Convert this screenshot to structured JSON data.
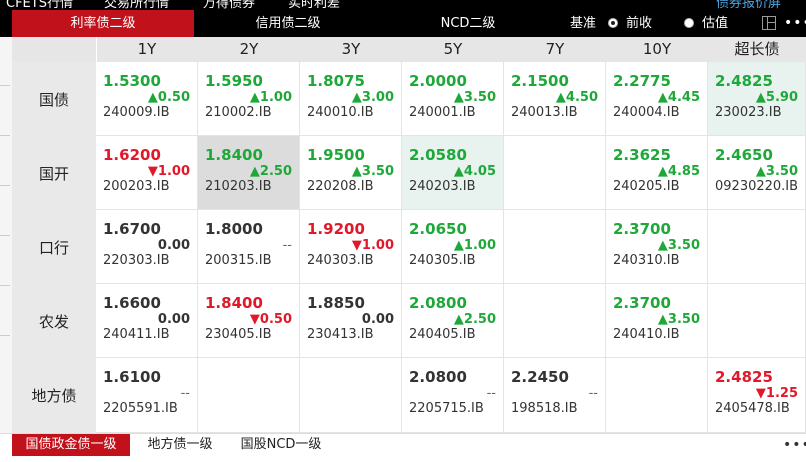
{
  "top_menu": [
    "CFETS行情",
    "交易所行情",
    "万得债券",
    "实时利差",
    "债券报价屏"
  ],
  "tabs": {
    "active": "利率债二级",
    "credit": "信用债二级",
    "ncd": "NCD二级",
    "basis_label": "基准",
    "opt_prev": "前收",
    "opt_est": "估值"
  },
  "grid": {
    "headers": [
      "1Y",
      "2Y",
      "3Y",
      "5Y",
      "7Y",
      "10Y",
      "超长债"
    ],
    "rows": [
      {
        "label": "国债",
        "cells": [
          {
            "y": "1.5300",
            "c": "▲0.50",
            "code": "240009.IB",
            "dir": "up"
          },
          {
            "y": "1.5950",
            "c": "▲1.00",
            "code": "210002.IB",
            "dir": "up"
          },
          {
            "y": "1.8075",
            "c": "▲3.00",
            "code": "240010.IB",
            "dir": "up"
          },
          {
            "y": "2.0000",
            "c": "▲3.50",
            "code": "240001.IB",
            "dir": "up"
          },
          {
            "y": "2.1500",
            "c": "▲4.50",
            "code": "240013.IB",
            "dir": "up"
          },
          {
            "y": "2.2775",
            "c": "▲4.45",
            "code": "240004.IB",
            "dir": "up"
          },
          {
            "y": "2.4825",
            "c": "▲5.90",
            "code": "230023.IB",
            "dir": "up",
            "hl": "green"
          }
        ]
      },
      {
        "label": "国开",
        "cells": [
          {
            "y": "1.6200",
            "c": "▼1.00",
            "code": "200203.IB",
            "dir": "down"
          },
          {
            "y": "1.8400",
            "c": "▲2.50",
            "code": "210203.IB",
            "dir": "up",
            "hl": "gray"
          },
          {
            "y": "1.9500",
            "c": "▲3.50",
            "code": "220208.IB",
            "dir": "up"
          },
          {
            "y": "2.0580",
            "c": "▲4.05",
            "code": "240203.IB",
            "dir": "up",
            "hl": "green"
          },
          null,
          {
            "y": "2.3625",
            "c": "▲4.85",
            "code": "240205.IB",
            "dir": "up"
          },
          {
            "y": "2.4650",
            "c": "▲3.50",
            "code": "09230220.IB",
            "dir": "up"
          }
        ]
      },
      {
        "label": "口行",
        "cells": [
          {
            "y": "1.6700",
            "c": "0.00",
            "code": "220303.IB",
            "dir": "flat"
          },
          {
            "y": "1.8000",
            "c": "--",
            "code": "200315.IB",
            "dir": "flat"
          },
          {
            "y": "1.9200",
            "c": "▼1.00",
            "code": "240303.IB",
            "dir": "down"
          },
          {
            "y": "2.0650",
            "c": "▲1.00",
            "code": "240305.IB",
            "dir": "up"
          },
          null,
          {
            "y": "2.3700",
            "c": "▲3.50",
            "code": "240310.IB",
            "dir": "up"
          },
          null
        ]
      },
      {
        "label": "农发",
        "cells": [
          {
            "y": "1.6600",
            "c": "0.00",
            "code": "240411.IB",
            "dir": "flat"
          },
          {
            "y": "1.8400",
            "c": "▼0.50",
            "code": "230405.IB",
            "dir": "down"
          },
          {
            "y": "1.8850",
            "c": "0.00",
            "code": "230413.IB",
            "dir": "flat"
          },
          {
            "y": "2.0800",
            "c": "▲2.50",
            "code": "240405.IB",
            "dir": "up"
          },
          null,
          {
            "y": "2.3700",
            "c": "▲3.50",
            "code": "240410.IB",
            "dir": "up"
          },
          null
        ]
      },
      {
        "label": "地方债",
        "cells": [
          {
            "y": "1.6100",
            "c": "--",
            "code": "2205591.IB",
            "dir": "flat"
          },
          null,
          null,
          {
            "y": "2.0800",
            "c": "--",
            "code": "2205715.IB",
            "dir": "flat"
          },
          {
            "y": "2.2450",
            "c": "--",
            "code": "198518.IB",
            "dir": "flat"
          },
          null,
          {
            "y": "2.4825",
            "c": "▼1.25",
            "code": "2405478.IB",
            "dir": "down"
          }
        ]
      }
    ]
  },
  "bottom_tabs": [
    "国债政金债一级",
    "地方债一级",
    "国股NCD一级"
  ],
  "more_glyph": "•••",
  "colors": {
    "accent": "#c1121c",
    "up": "#1fa83a",
    "down": "#e0192a"
  }
}
